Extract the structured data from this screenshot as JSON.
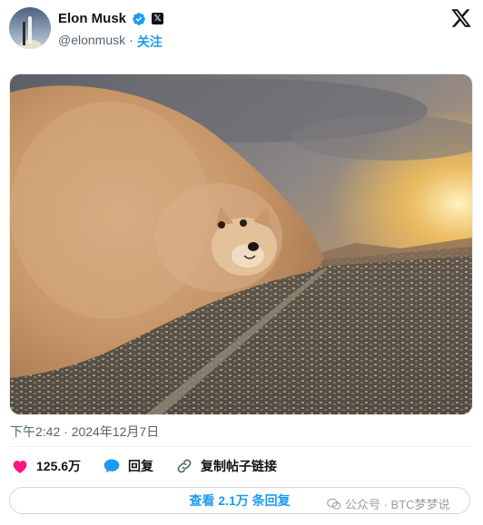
{
  "author": {
    "name": "Elon Musk",
    "handle": "@elonmusk",
    "separator": "·",
    "follow_label": "关注"
  },
  "post": {
    "image_alt": "Dust storm shaped like a Shiba Inu dog rolling over a city",
    "timestamp": "下午2:42 · 2024年12月7日"
  },
  "actions": {
    "likes": "125.6万",
    "reply_label": "回复",
    "copy_link_label": "复制帖子链接"
  },
  "replies_button": "查看 2.1万 条回复",
  "watermark": "公众号 · BTC梦梦说",
  "colors": {
    "accent": "#1d9bf0",
    "like": "#f91880",
    "text": "#0f1419",
    "muted": "#536471"
  }
}
